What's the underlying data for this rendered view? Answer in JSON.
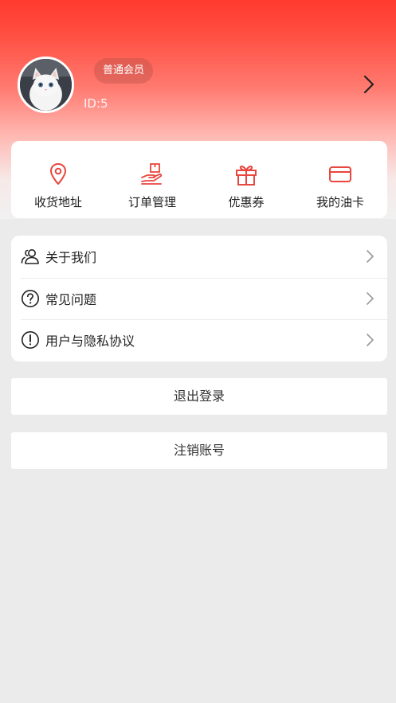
{
  "profile": {
    "member_level": "普通会员",
    "user_id": "ID:5",
    "avatar": "avatar-photo"
  },
  "quick_actions": [
    {
      "label": "收货地址",
      "icon": "location-pin-icon"
    },
    {
      "label": "订单管理",
      "icon": "hand-box-icon"
    },
    {
      "label": "优惠券",
      "icon": "gift-icon"
    },
    {
      "label": "我的油卡",
      "icon": "card-icon"
    }
  ],
  "menu": [
    {
      "label": "关于我们",
      "icon": "people-icon"
    },
    {
      "label": "常见问题",
      "icon": "question-circle-icon"
    },
    {
      "label": "用户与隐私协议",
      "icon": "exclamation-circle-icon"
    }
  ],
  "buttons": {
    "logout": "退出登录",
    "deactivate": "注销账号"
  },
  "colors": {
    "accent": "#e8463e",
    "header_top": "#ff3a2e",
    "background": "#ebebeb"
  }
}
